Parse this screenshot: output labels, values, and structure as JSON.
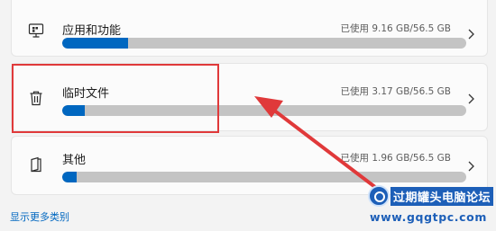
{
  "storage_items": [
    {
      "title": "应用和功能",
      "usage": "已使用 9.16 GB/56.5 GB",
      "fill_fraction": 0.162,
      "icon": "apps-icon"
    },
    {
      "title": "临时文件",
      "usage": "已使用 3.17 GB/56.5 GB",
      "fill_fraction": 0.056,
      "icon": "trash-icon"
    },
    {
      "title": "其他",
      "usage": "已使用 1.96 GB/56.5 GB",
      "fill_fraction": 0.035,
      "icon": "document-icon"
    }
  ],
  "more_link": "显示更多类别",
  "colors": {
    "accent": "#0067c0",
    "track": "#c4c4c4",
    "annotation": "#e0393a"
  },
  "watermark": {
    "title": "过期罐头电脑论坛",
    "url": "www.gqgtpc.com"
  }
}
